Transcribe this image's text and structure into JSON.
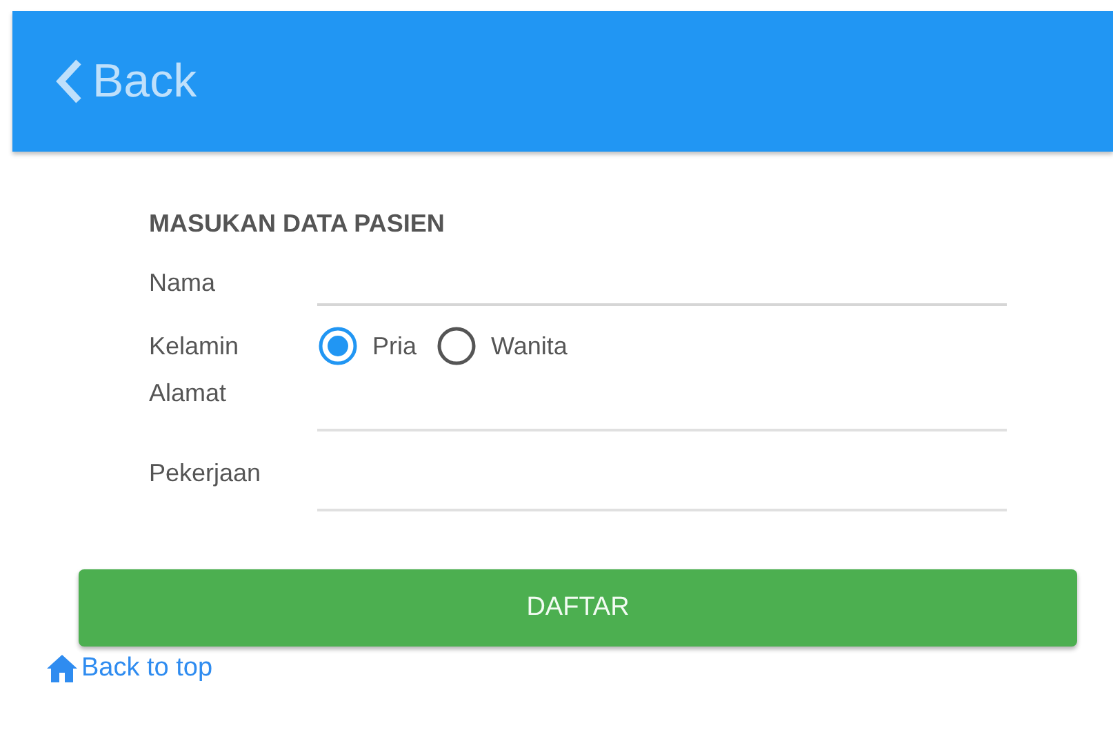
{
  "header": {
    "back": "Back"
  },
  "form": {
    "title": "MASUKAN DATA PASIEN",
    "fields": [
      {
        "kind": "text",
        "label": "Nama"
      },
      {
        "kind": "radio",
        "label": "Kelamin",
        "options": [
          {
            "label": "Pria",
            "selected": true
          },
          {
            "label": "Wanita",
            "selected": false
          }
        ]
      },
      {
        "kind": "text",
        "label": "Alamat"
      },
      {
        "kind": "text",
        "label": "Pekerjaan"
      }
    ]
  },
  "submit": "DAFTAR",
  "back_to_top": "Back to top"
}
